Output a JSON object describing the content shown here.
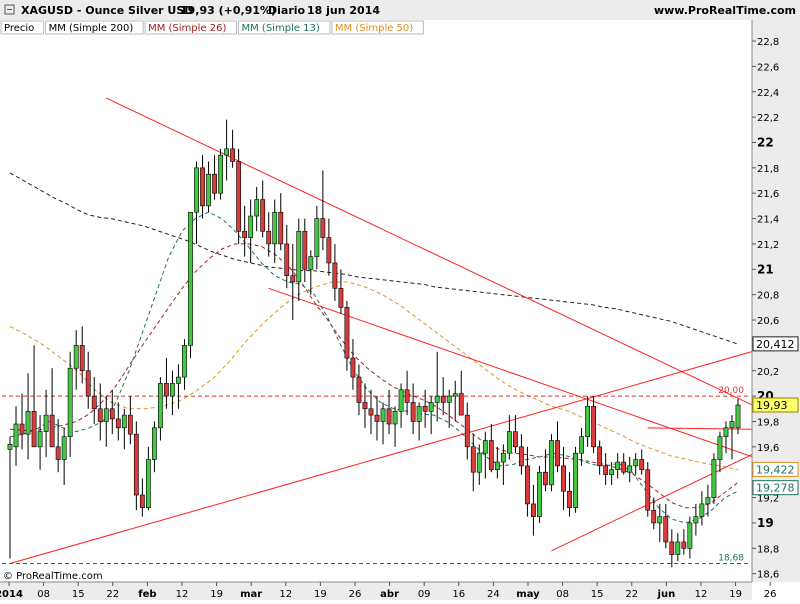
{
  "header": {
    "symbol": "XAGUSD - Ounce Silver USD",
    "price": "19,93 (+0,91%)",
    "period": "Diario",
    "date": "18 jun 2014",
    "site": "www.ProRealTime.com"
  },
  "legend": [
    {
      "label": "Precio",
      "color": "#000000"
    },
    {
      "label": "MM (Simple 200)",
      "color": "#000000"
    },
    {
      "label": "MM (Simple 26)",
      "color": "#a02020"
    },
    {
      "label": "MM (Simple 13)",
      "color": "#207060"
    },
    {
      "label": "MM (Simple 50)",
      "color": "#e09020"
    }
  ],
  "copyright": "© ProRealTime.com",
  "chart_data": {
    "type": "candlestick",
    "ylim": [
      18.55,
      22.95
    ],
    "y_ticks": [
      "22,8",
      "22,6",
      "22,4",
      "22,2",
      "22",
      "21,8",
      "21,6",
      "21,4",
      "21,2",
      "21",
      "20,8",
      "20,6",
      "20,4",
      "20,2",
      "20",
      "19,8",
      "19,6",
      "19,4",
      "19,2",
      "19",
      "18,8",
      "18,6"
    ],
    "x_ticks": [
      "2014",
      "08",
      "15",
      "22",
      "feb",
      "12",
      "19",
      "mar",
      "12",
      "19",
      "26",
      "abr",
      "09",
      "16",
      "24",
      "may",
      "08",
      "15",
      "22",
      "jun",
      "12",
      "19",
      "26"
    ],
    "colors": {
      "up": "#44c844",
      "down": "#d83c3c",
      "trendline": "#ff2020"
    },
    "candles": [
      {
        "o": 19.58,
        "h": 19.68,
        "l": 18.72,
        "c": 19.62
      },
      {
        "o": 19.6,
        "h": 19.92,
        "l": 19.45,
        "c": 19.78
      },
      {
        "o": 19.78,
        "h": 20.02,
        "l": 19.58,
        "c": 19.7
      },
      {
        "o": 19.7,
        "h": 20.18,
        "l": 19.5,
        "c": 19.88
      },
      {
        "o": 19.88,
        "h": 20.4,
        "l": 19.68,
        "c": 19.6
      },
      {
        "o": 19.6,
        "h": 19.85,
        "l": 19.42,
        "c": 19.72
      },
      {
        "o": 19.72,
        "h": 20.05,
        "l": 19.52,
        "c": 19.85
      },
      {
        "o": 19.85,
        "h": 20.22,
        "l": 19.7,
        "c": 19.6
      },
      {
        "o": 19.6,
        "h": 19.82,
        "l": 19.4,
        "c": 19.5
      },
      {
        "o": 19.5,
        "h": 19.75,
        "l": 19.3,
        "c": 19.68
      },
      {
        "o": 19.68,
        "h": 20.35,
        "l": 19.52,
        "c": 20.22
      },
      {
        "o": 20.22,
        "h": 20.52,
        "l": 20.05,
        "c": 20.4
      },
      {
        "o": 20.4,
        "h": 20.55,
        "l": 20.1,
        "c": 20.2
      },
      {
        "o": 20.2,
        "h": 20.35,
        "l": 19.9,
        "c": 20.0
      },
      {
        "o": 20.0,
        "h": 20.15,
        "l": 19.78,
        "c": 19.9
      },
      {
        "o": 19.9,
        "h": 20.1,
        "l": 19.65,
        "c": 19.8
      },
      {
        "o": 19.8,
        "h": 20.0,
        "l": 19.6,
        "c": 19.9
      },
      {
        "o": 19.9,
        "h": 20.05,
        "l": 19.7,
        "c": 19.82
      },
      {
        "o": 19.82,
        "h": 19.95,
        "l": 19.65,
        "c": 19.75
      },
      {
        "o": 19.75,
        "h": 19.9,
        "l": 19.58,
        "c": 19.85
      },
      {
        "o": 19.85,
        "h": 20.0,
        "l": 19.62,
        "c": 19.7
      },
      {
        "o": 19.7,
        "h": 19.8,
        "l": 19.1,
        "c": 19.22
      },
      {
        "o": 19.22,
        "h": 19.35,
        "l": 19.05,
        "c": 19.12
      },
      {
        "o": 19.12,
        "h": 19.6,
        "l": 19.1,
        "c": 19.5
      },
      {
        "o": 19.5,
        "h": 19.8,
        "l": 19.4,
        "c": 19.75
      },
      {
        "o": 19.75,
        "h": 20.15,
        "l": 19.65,
        "c": 20.1
      },
      {
        "o": 20.1,
        "h": 20.3,
        "l": 19.9,
        "c": 20.0
      },
      {
        "o": 20.0,
        "h": 20.2,
        "l": 19.85,
        "c": 20.1
      },
      {
        "o": 20.1,
        "h": 20.25,
        "l": 19.9,
        "c": 20.15
      },
      {
        "o": 20.15,
        "h": 20.45,
        "l": 20.05,
        "c": 20.4
      },
      {
        "o": 20.4,
        "h": 21.25,
        "l": 20.3,
        "c": 21.45
      },
      {
        "o": 21.45,
        "h": 21.85,
        "l": 21.2,
        "c": 21.8
      },
      {
        "o": 21.8,
        "h": 21.9,
        "l": 21.4,
        "c": 21.5
      },
      {
        "o": 21.5,
        "h": 21.85,
        "l": 21.45,
        "c": 21.75
      },
      {
        "o": 21.75,
        "h": 21.9,
        "l": 21.55,
        "c": 21.6
      },
      {
        "o": 21.6,
        "h": 21.95,
        "l": 21.55,
        "c": 21.9
      },
      {
        "o": 21.9,
        "h": 22.18,
        "l": 21.7,
        "c": 21.95
      },
      {
        "o": 21.95,
        "h": 22.1,
        "l": 21.8,
        "c": 21.85
      },
      {
        "o": 21.85,
        "h": 21.95,
        "l": 21.2,
        "c": 21.3
      },
      {
        "o": 21.3,
        "h": 21.5,
        "l": 21.1,
        "c": 21.25
      },
      {
        "o": 21.25,
        "h": 21.55,
        "l": 21.05,
        "c": 21.42
      },
      {
        "o": 21.42,
        "h": 21.65,
        "l": 21.3,
        "c": 21.55
      },
      {
        "o": 21.55,
        "h": 21.7,
        "l": 21.25,
        "c": 21.3
      },
      {
        "o": 21.3,
        "h": 21.45,
        "l": 21.1,
        "c": 21.2
      },
      {
        "o": 21.2,
        "h": 21.55,
        "l": 21.05,
        "c": 21.45
      },
      {
        "o": 21.45,
        "h": 21.6,
        "l": 21.15,
        "c": 21.2
      },
      {
        "o": 21.2,
        "h": 21.35,
        "l": 20.85,
        "c": 20.95
      },
      {
        "o": 20.95,
        "h": 21.2,
        "l": 20.6,
        "c": 20.9
      },
      {
        "o": 20.9,
        "h": 21.4,
        "l": 20.75,
        "c": 21.3
      },
      {
        "o": 21.3,
        "h": 21.4,
        "l": 20.9,
        "c": 21.0
      },
      {
        "o": 21.0,
        "h": 21.15,
        "l": 20.8,
        "c": 21.1
      },
      {
        "o": 21.1,
        "h": 21.5,
        "l": 21.0,
        "c": 21.4
      },
      {
        "o": 21.4,
        "h": 21.78,
        "l": 21.15,
        "c": 21.25
      },
      {
        "o": 21.25,
        "h": 21.4,
        "l": 20.95,
        "c": 21.05
      },
      {
        "o": 21.05,
        "h": 21.2,
        "l": 20.75,
        "c": 20.85
      },
      {
        "o": 20.85,
        "h": 21.0,
        "l": 20.65,
        "c": 20.7
      },
      {
        "o": 20.7,
        "h": 20.75,
        "l": 20.2,
        "c": 20.3
      },
      {
        "o": 20.3,
        "h": 20.45,
        "l": 20.05,
        "c": 20.15
      },
      {
        "o": 20.15,
        "h": 20.25,
        "l": 19.85,
        "c": 19.95
      },
      {
        "o": 19.95,
        "h": 20.1,
        "l": 19.75,
        "c": 19.9
      },
      {
        "o": 19.9,
        "h": 20.05,
        "l": 19.7,
        "c": 19.85
      },
      {
        "o": 19.85,
        "h": 20.0,
        "l": 19.65,
        "c": 19.8
      },
      {
        "o": 19.8,
        "h": 19.95,
        "l": 19.62,
        "c": 19.9
      },
      {
        "o": 19.9,
        "h": 20.05,
        "l": 19.7,
        "c": 19.78
      },
      {
        "o": 19.78,
        "h": 19.92,
        "l": 19.6,
        "c": 19.88
      },
      {
        "o": 19.88,
        "h": 20.1,
        "l": 19.75,
        "c": 20.05
      },
      {
        "o": 20.05,
        "h": 20.2,
        "l": 19.85,
        "c": 19.95
      },
      {
        "o": 19.95,
        "h": 20.1,
        "l": 19.7,
        "c": 19.8
      },
      {
        "o": 19.8,
        "h": 19.95,
        "l": 19.65,
        "c": 19.92
      },
      {
        "o": 19.92,
        "h": 20.05,
        "l": 19.75,
        "c": 19.88
      },
      {
        "o": 19.88,
        "h": 20.0,
        "l": 19.7,
        "c": 19.95
      },
      {
        "o": 19.95,
        "h": 20.35,
        "l": 19.8,
        "c": 20.0
      },
      {
        "o": 20.0,
        "h": 20.15,
        "l": 19.85,
        "c": 19.95
      },
      {
        "o": 19.95,
        "h": 20.05,
        "l": 19.75,
        "c": 20.0
      },
      {
        "o": 20.0,
        "h": 20.12,
        "l": 19.8,
        "c": 20.02
      },
      {
        "o": 20.02,
        "h": 20.2,
        "l": 19.9,
        "c": 19.85
      },
      {
        "o": 19.85,
        "h": 19.95,
        "l": 19.5,
        "c": 19.6
      },
      {
        "o": 19.6,
        "h": 19.7,
        "l": 19.25,
        "c": 19.4
      },
      {
        "o": 19.4,
        "h": 19.62,
        "l": 19.3,
        "c": 19.55
      },
      {
        "o": 19.55,
        "h": 19.72,
        "l": 19.35,
        "c": 19.65
      },
      {
        "o": 19.65,
        "h": 19.78,
        "l": 19.4,
        "c": 19.42
      },
      {
        "o": 19.42,
        "h": 19.6,
        "l": 19.35,
        "c": 19.48
      },
      {
        "o": 19.48,
        "h": 19.62,
        "l": 19.3,
        "c": 19.55
      },
      {
        "o": 19.55,
        "h": 19.85,
        "l": 19.5,
        "c": 19.72
      },
      {
        "o": 19.72,
        "h": 19.85,
        "l": 19.55,
        "c": 19.6
      },
      {
        "o": 19.6,
        "h": 19.7,
        "l": 19.38,
        "c": 19.45
      },
      {
        "o": 19.45,
        "h": 19.6,
        "l": 19.05,
        "c": 19.15
      },
      {
        "o": 19.15,
        "h": 19.3,
        "l": 18.9,
        "c": 19.05
      },
      {
        "o": 19.05,
        "h": 19.45,
        "l": 19.0,
        "c": 19.4
      },
      {
        "o": 19.4,
        "h": 19.58,
        "l": 19.25,
        "c": 19.3
      },
      {
        "o": 19.3,
        "h": 19.7,
        "l": 19.25,
        "c": 19.65
      },
      {
        "o": 19.65,
        "h": 19.8,
        "l": 19.4,
        "c": 19.45
      },
      {
        "o": 19.45,
        "h": 19.6,
        "l": 19.1,
        "c": 19.25
      },
      {
        "o": 19.25,
        "h": 19.4,
        "l": 19.05,
        "c": 19.12
      },
      {
        "o": 19.12,
        "h": 19.6,
        "l": 19.08,
        "c": 19.55
      },
      {
        "o": 19.55,
        "h": 19.75,
        "l": 19.45,
        "c": 19.68
      },
      {
        "o": 19.68,
        "h": 20.0,
        "l": 19.6,
        "c": 19.92
      },
      {
        "o": 19.92,
        "h": 20.0,
        "l": 19.55,
        "c": 19.6
      },
      {
        "o": 19.6,
        "h": 19.65,
        "l": 19.38,
        "c": 19.45
      },
      {
        "o": 19.45,
        "h": 19.55,
        "l": 19.3,
        "c": 19.38
      },
      {
        "o": 19.38,
        "h": 19.48,
        "l": 19.3,
        "c": 19.42
      },
      {
        "o": 19.42,
        "h": 19.55,
        "l": 19.35,
        "c": 19.48
      },
      {
        "o": 19.48,
        "h": 19.55,
        "l": 19.38,
        "c": 19.4
      },
      {
        "o": 19.4,
        "h": 19.52,
        "l": 19.32,
        "c": 19.45
      },
      {
        "o": 19.45,
        "h": 19.55,
        "l": 19.38,
        "c": 19.5
      },
      {
        "o": 19.5,
        "h": 19.58,
        "l": 19.38,
        "c": 19.42
      },
      {
        "o": 19.42,
        "h": 19.48,
        "l": 19.05,
        "c": 19.1
      },
      {
        "o": 19.1,
        "h": 19.2,
        "l": 18.95,
        "c": 19.0
      },
      {
        "o": 19.0,
        "h": 19.15,
        "l": 18.85,
        "c": 19.05
      },
      {
        "o": 19.05,
        "h": 19.15,
        "l": 18.8,
        "c": 18.85
      },
      {
        "o": 18.85,
        "h": 18.95,
        "l": 18.65,
        "c": 18.75
      },
      {
        "o": 18.75,
        "h": 18.92,
        "l": 18.7,
        "c": 18.85
      },
      {
        "o": 18.85,
        "h": 18.95,
        "l": 18.75,
        "c": 18.8
      },
      {
        "o": 18.8,
        "h": 19.05,
        "l": 18.72,
        "c": 19.0
      },
      {
        "o": 19.0,
        "h": 19.15,
        "l": 18.9,
        "c": 19.05
      },
      {
        "o": 19.05,
        "h": 19.25,
        "l": 18.98,
        "c": 19.15
      },
      {
        "o": 19.15,
        "h": 19.3,
        "l": 19.05,
        "c": 19.2
      },
      {
        "o": 19.2,
        "h": 19.55,
        "l": 19.15,
        "c": 19.5
      },
      {
        "o": 19.5,
        "h": 19.72,
        "l": 19.4,
        "c": 19.68
      },
      {
        "o": 19.68,
        "h": 19.8,
        "l": 19.55,
        "c": 19.75
      },
      {
        "o": 19.75,
        "h": 19.85,
        "l": 19.5,
        "c": 19.8
      },
      {
        "o": 19.75,
        "h": 19.98,
        "l": 19.7,
        "c": 19.93
      }
    ],
    "moving_averages": [
      {
        "name": "MM (Simple 200)",
        "color": "#222222",
        "dash": "4 3",
        "values": [
          21.76,
          21.71,
          21.66,
          21.61,
          21.56,
          21.52,
          21.47,
          21.43,
          21.41,
          21.4,
          21.38,
          21.36,
          21.34,
          21.31,
          21.28,
          21.25,
          21.22,
          21.18,
          21.14,
          21.11,
          21.08,
          21.06,
          21.04,
          21.02,
          21.01,
          21.0,
          20.99,
          20.99,
          20.98,
          20.97,
          20.96,
          20.94,
          20.93,
          20.92,
          20.91,
          20.9,
          20.89,
          20.88,
          20.86,
          20.85,
          20.84,
          20.83,
          20.82,
          20.81,
          20.8,
          20.79,
          20.78,
          20.77,
          20.76,
          20.75,
          20.74,
          20.73,
          20.72,
          20.7,
          20.69,
          20.67,
          20.65,
          20.63,
          20.61,
          20.59,
          20.56,
          20.53,
          20.5,
          20.47,
          20.44,
          20.41
        ]
      },
      {
        "name": "MM (Simple 26)",
        "color": "#a02020",
        "dash": "4 3",
        "values": [
          19.74,
          19.73,
          19.73,
          19.75,
          19.77,
          19.8,
          19.86,
          19.96,
          20.08,
          20.24,
          20.4,
          20.55,
          20.7,
          20.85,
          20.98,
          21.08,
          21.16,
          21.2,
          21.2,
          21.18,
          21.12,
          21.03,
          20.9,
          20.74,
          20.6,
          20.45,
          20.32,
          20.22,
          20.14,
          20.07,
          20.02,
          19.98,
          19.93,
          19.86,
          19.78,
          19.7,
          19.62,
          19.58,
          19.55,
          19.54,
          19.52,
          19.52,
          19.51,
          19.5,
          19.48,
          19.46,
          19.43,
          19.39,
          19.32,
          19.24,
          19.16,
          19.12,
          19.12,
          19.16,
          19.24,
          19.32
        ]
      },
      {
        "name": "MM (Simple 13)",
        "color": "#207060",
        "dash": "4 3",
        "values": [
          19.68,
          19.7,
          19.74,
          19.8,
          19.75,
          19.72,
          19.75,
          19.8,
          19.95,
          20.2,
          20.5,
          20.8,
          21.1,
          21.3,
          21.4,
          21.45,
          21.4,
          21.3,
          21.18,
          21.05,
          20.95,
          20.9,
          20.88,
          20.8,
          20.62,
          20.4,
          20.2,
          20.05,
          19.95,
          19.9,
          19.88,
          19.86,
          19.85,
          19.8,
          19.72,
          19.62,
          19.52,
          19.45,
          19.46,
          19.5,
          19.52,
          19.55,
          19.53,
          19.5,
          19.46,
          19.45,
          19.47,
          19.4,
          19.26,
          19.12,
          19.03,
          19.0,
          19.03,
          19.1,
          19.2,
          19.25
        ]
      },
      {
        "name": "MM (Simple 50)",
        "color": "#e09020",
        "dash": "4 3",
        "values": [
          20.55,
          20.48,
          20.4,
          20.3,
          20.2,
          20.05,
          19.95,
          19.9,
          19.9,
          19.92,
          19.96,
          20.04,
          20.14,
          20.28,
          20.44,
          20.58,
          20.7,
          20.8,
          20.86,
          20.9,
          20.9,
          20.86,
          20.8,
          20.72,
          20.62,
          20.52,
          20.42,
          20.32,
          20.22,
          20.12,
          20.04,
          19.98,
          19.92,
          19.88,
          19.82,
          19.76,
          19.7,
          19.63,
          19.58,
          19.53,
          19.5,
          19.47,
          19.45,
          19.42
        ]
      }
    ],
    "trendlines": [
      {
        "from": [
          16,
          22.35
        ],
        "to": [
          138,
          19.6
        ]
      },
      {
        "from": [
          43,
          20.85
        ],
        "to": [
          138,
          19.28
        ]
      },
      {
        "from": [
          0,
          18.68
        ],
        "to": [
          138,
          20.55
        ]
      },
      {
        "from": [
          90,
          18.78
        ],
        "to": [
          126,
          19.6
        ]
      },
      {
        "from": [
          106,
          19.75
        ],
        "to": [
          138,
          19.73
        ]
      }
    ],
    "price_lines": [
      {
        "value": 20.0,
        "label": "20,00",
        "color": "#e03030"
      },
      {
        "value": 18.68,
        "label": "18,68",
        "color": "#207060"
      }
    ],
    "markers": [
      {
        "value": 20.412,
        "label": "20,412",
        "bg": "#ffffff",
        "border": "#222222",
        "text": "#000000"
      },
      {
        "value": 19.93,
        "label": "19,93",
        "bg": "#ffff66",
        "border": "#888800",
        "text": "#000000"
      },
      {
        "value": 19.422,
        "label": "19,422",
        "bg": "#ffffff",
        "border": "#e09020",
        "text": "#207060"
      },
      {
        "value": 19.278,
        "label": "19,278",
        "bg": "#ffffff",
        "border": "#207060",
        "text": "#207060"
      }
    ]
  }
}
